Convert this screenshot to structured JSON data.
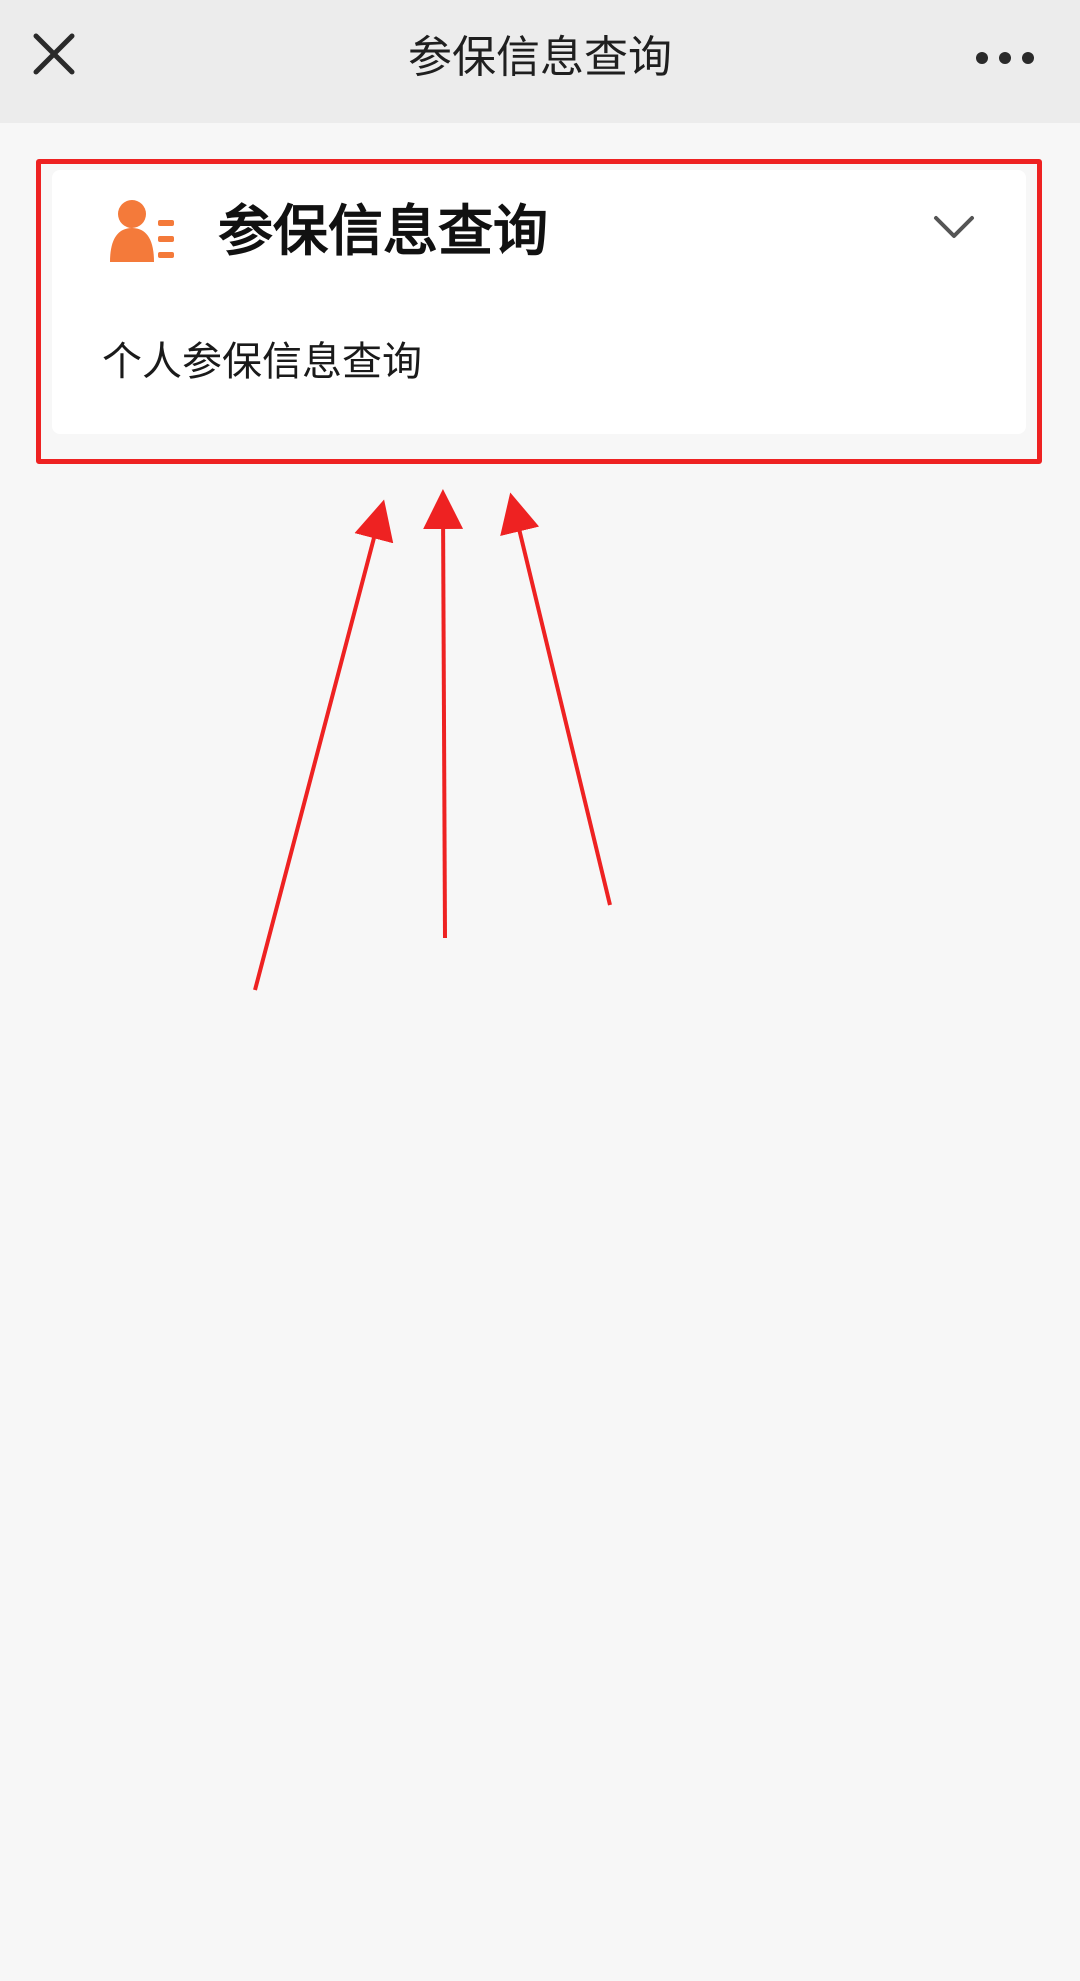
{
  "nav": {
    "title": "参保信息查询",
    "close_icon": "close-icon",
    "more_icon": "more-dots-icon"
  },
  "card": {
    "title": "参保信息查询",
    "icon": "person-id-icon",
    "icon_color": "#f47a3a",
    "chevron_icon": "chevron-down-icon",
    "items": [
      {
        "label": "个人参保信息查询"
      }
    ]
  },
  "annotation": {
    "highlight_color": "#ee2222",
    "arrow_count": 3
  }
}
